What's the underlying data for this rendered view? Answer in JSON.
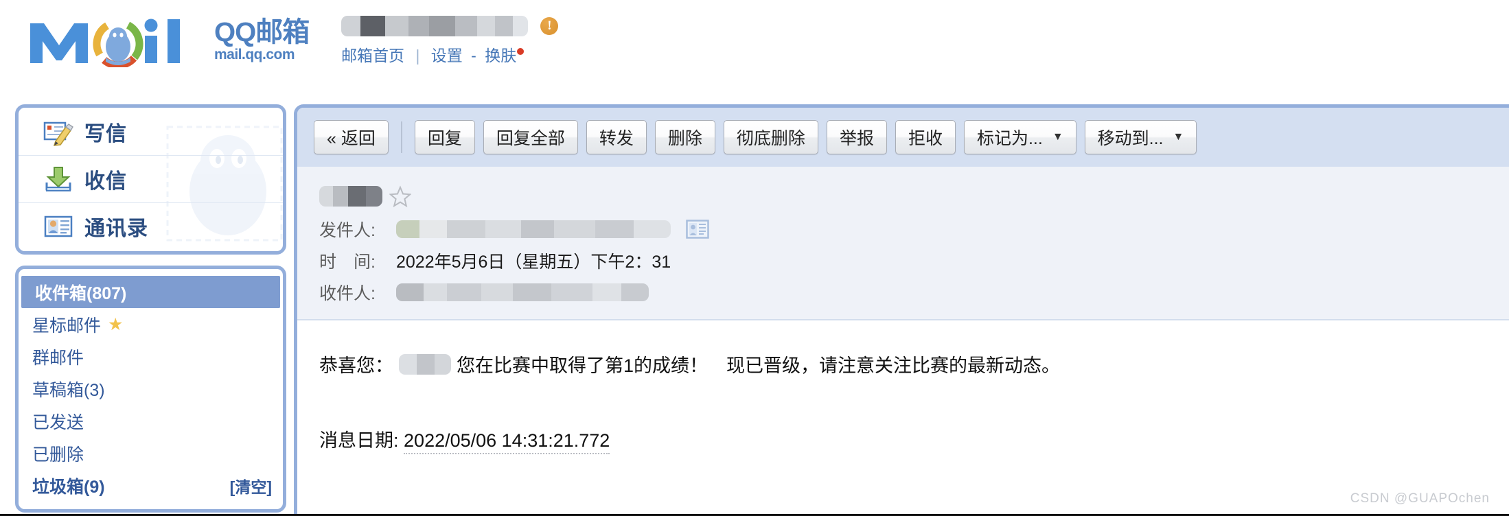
{
  "brand": {
    "logo_text": "Mail",
    "name_cn": "QQ邮箱",
    "url": "mail.qq.com"
  },
  "header": {
    "account_redacted": true,
    "warning_badge": "!",
    "links": {
      "home": "邮箱首页",
      "separator": "|",
      "settings": "设置",
      "dash": "-",
      "skin": "换肤",
      "skin_new_dot": true
    }
  },
  "sidebar": {
    "nav": [
      {
        "label": "写信",
        "icon": "compose-icon"
      },
      {
        "label": "收信",
        "icon": "receive-icon"
      },
      {
        "label": "通讯录",
        "icon": "contacts-icon"
      }
    ],
    "folders": [
      {
        "label": "收件箱(807)",
        "selected": true,
        "bold": true,
        "star": false,
        "action": ""
      },
      {
        "label": "星标邮件",
        "selected": false,
        "bold": false,
        "star": true,
        "action": ""
      },
      {
        "label": "群邮件",
        "selected": false,
        "bold": false,
        "star": false,
        "action": ""
      },
      {
        "label": "草稿箱(3)",
        "selected": false,
        "bold": false,
        "star": false,
        "action": ""
      },
      {
        "label": "已发送",
        "selected": false,
        "bold": false,
        "star": false,
        "action": ""
      },
      {
        "label": "已删除",
        "selected": false,
        "bold": false,
        "star": false,
        "action": ""
      },
      {
        "label": "垃圾箱(9)",
        "selected": false,
        "bold": true,
        "star": false,
        "action": "[清空]"
      }
    ]
  },
  "toolbar": {
    "back": "« 返回",
    "reply": "回复",
    "reply_all": "回复全部",
    "forward": "转发",
    "delete": "删除",
    "delete_forever": "彻底删除",
    "report": "举报",
    "reject": "拒收",
    "mark_as": "标记为...",
    "move_to": "移动到...",
    "caret": "▼"
  },
  "mail": {
    "subject_redacted": true,
    "starred": false,
    "labels": {
      "from": "发件人:",
      "time": "时　间:",
      "to": "收件人:"
    },
    "from_redacted": true,
    "time": "2022年5月6日（星期五）下午2：31",
    "to_redacted": true,
    "body": {
      "greeting_prefix": "恭喜您：",
      "name_redacted": true,
      "greeting_suffix": "您在比赛中取得了第1的成绩！　现已晋级，请注意关注比赛的最新动态。",
      "date_label": "消息日期:",
      "date_value": "2022/05/06 14:31:21.772"
    }
  },
  "watermark": "CSDN @GUAPOchen",
  "colors": {
    "brand_blue": "#4e80c0",
    "panel_border": "#93aedb",
    "toolbar_bg": "#d4dff1",
    "selected_folder": "#7e9cd0",
    "link_blue": "#4677b7",
    "header_bg": "#eff2f8",
    "badge_orange": "#d9912f",
    "new_dot_red": "#d93b26",
    "star_yellow": "#f2c24a"
  }
}
